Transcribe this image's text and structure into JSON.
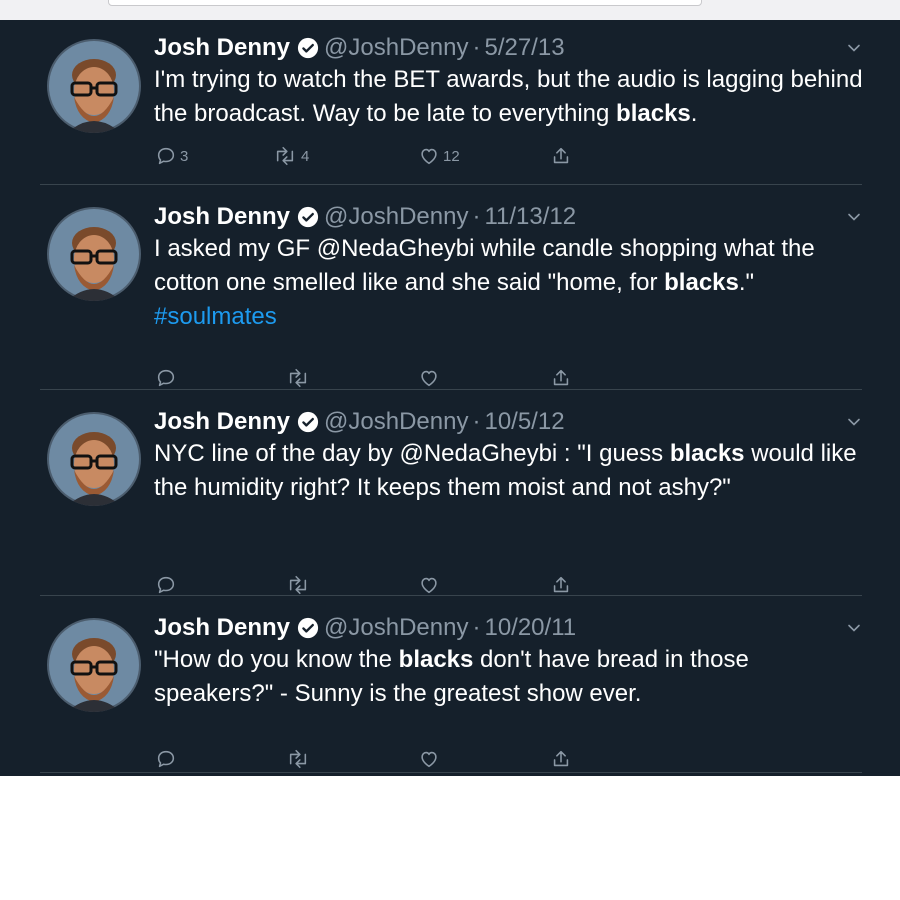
{
  "tweets": [
    {
      "name": "Josh Denny",
      "handle": "@JoshDenny",
      "separator": "·",
      "date": "5/27/13",
      "text_parts": [
        "I'm trying to watch the BET awards, but the audio is lagging behind the broadcast. Way to be late to everything ",
        "blacks",
        "."
      ],
      "replies": "3",
      "retweets": "4",
      "likes": "12"
    },
    {
      "name": "Josh Denny",
      "handle": "@JoshDenny",
      "separator": "·",
      "date": "11/13/12",
      "text_parts": [
        "I asked my GF @NedaGheybi while candle shopping what the cotton one smelled like and she said \"home, for ",
        "blacks",
        ".\" ",
        "#soulmates"
      ],
      "replies": "",
      "retweets": "",
      "likes": ""
    },
    {
      "name": "Josh Denny",
      "handle": "@JoshDenny",
      "separator": "·",
      "date": "10/5/12",
      "text_parts": [
        "NYC line of the day by @NedaGheybi : \"I guess ",
        "blacks",
        " would like the humidity right? It keeps them moist and not ashy?\""
      ],
      "replies": "",
      "retweets": "",
      "likes": ""
    },
    {
      "name": "Josh Denny",
      "handle": "@JoshDenny",
      "separator": "·",
      "date": "10/20/11",
      "text_parts": [
        "\"How do you know the ",
        "blacks",
        " don't have bread in those speakers?\" - Sunny is the greatest show ever."
      ],
      "replies": "",
      "retweets": "",
      "likes": ""
    }
  ],
  "colors": {
    "background": "#15202b",
    "text": "#ffffff",
    "secondary": "#8b98a5",
    "link": "#1d9bf0",
    "verified": "#ffffff"
  },
  "icons": [
    "avatar",
    "verified-badge-icon",
    "chevron-down-icon",
    "reply-icon",
    "retweet-icon",
    "like-icon",
    "share-icon"
  ]
}
